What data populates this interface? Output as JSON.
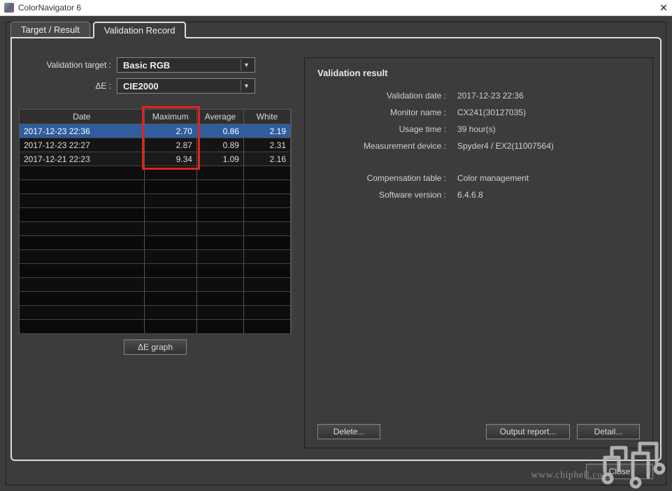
{
  "window": {
    "title": "ColorNavigator 6"
  },
  "tabs": {
    "target_result": "Target / Result",
    "validation_record": "Validation Record"
  },
  "form": {
    "target_label": "Validation target :",
    "target_value": "Basic RGB",
    "de_label": "ΔE :",
    "de_value": "CIE2000"
  },
  "table": {
    "headers": {
      "date": "Date",
      "max": "Maximum",
      "avg": "Average",
      "white": "White"
    },
    "rows": [
      {
        "date": "2017-12-23 22:36",
        "max": "2.70",
        "avg": "0.86",
        "white": "2.19",
        "selected": true
      },
      {
        "date": "2017-12-23 22:27",
        "max": "2.87",
        "avg": "0.89",
        "white": "2.31",
        "selected": false
      },
      {
        "date": "2017-12-21 22:23",
        "max": "9.34",
        "avg": "1.09",
        "white": "2.16",
        "selected": false
      }
    ],
    "empty_rows": 12
  },
  "buttons": {
    "de_graph": "ΔE graph",
    "delete": "Delete...",
    "output_report": "Output report...",
    "detail": "Detail...",
    "close": "Close"
  },
  "result": {
    "heading": "Validation result",
    "fields": [
      {
        "k": "Validation date :",
        "v": "2017-12-23 22:36"
      },
      {
        "k": "Monitor name :",
        "v": "CX241(30127035)"
      },
      {
        "k": "Usage time :",
        "v": "39 hour(s)"
      },
      {
        "k": "Measurement device :",
        "v": "Spyder4 / EX2(11007564)"
      }
    ],
    "fields2": [
      {
        "k": "Compensation table :",
        "v": "Color management"
      },
      {
        "k": "Software version :",
        "v": "6.4.6.8"
      }
    ]
  },
  "watermark": "www.chiphell.com"
}
